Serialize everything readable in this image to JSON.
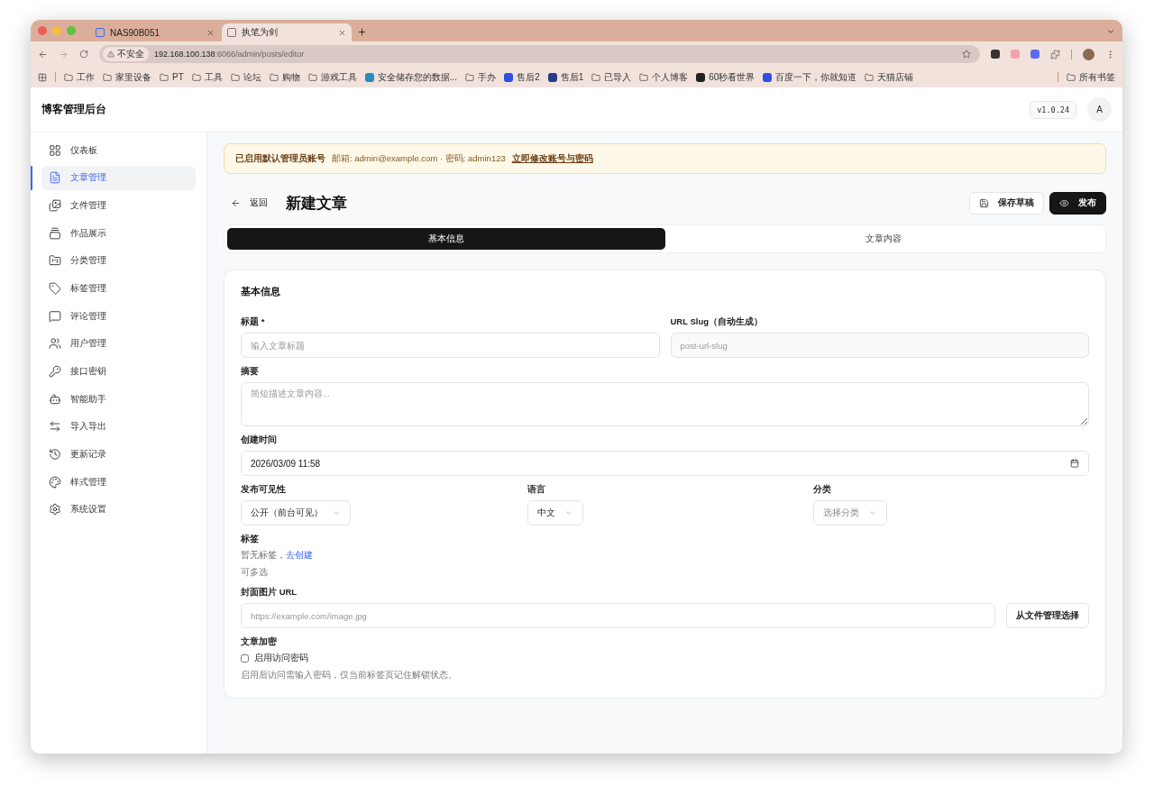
{
  "browser": {
    "tabs": [
      {
        "title": "NAS90B051",
        "selected": false
      },
      {
        "title": "执笔为剑",
        "selected": true
      }
    ],
    "address": {
      "security": "不安全",
      "host": "192.168.100.138",
      "path": ":6066/admin/posts/editor"
    },
    "bookmarks": [
      {
        "kind": "folder",
        "label": "工作"
      },
      {
        "kind": "folder",
        "label": "家里设备"
      },
      {
        "kind": "folder",
        "label": "PT"
      },
      {
        "kind": "folder",
        "label": "工具"
      },
      {
        "kind": "folder",
        "label": "论坛"
      },
      {
        "kind": "folder",
        "label": "购物"
      },
      {
        "kind": "folder",
        "label": "游戏工具"
      },
      {
        "kind": "site",
        "label": "安全储存您的数据..."
      },
      {
        "kind": "folder",
        "label": "手办"
      },
      {
        "kind": "site",
        "label": "售后2"
      },
      {
        "kind": "site",
        "label": "售后1"
      },
      {
        "kind": "folder",
        "label": "已导入"
      },
      {
        "kind": "folder",
        "label": "个人博客"
      },
      {
        "kind": "site",
        "label": "60秒看世界"
      },
      {
        "kind": "site",
        "label": "百度一下，你就知道"
      },
      {
        "kind": "folder",
        "label": "天猫店铺"
      }
    ],
    "all_bookmarks": "所有书签"
  },
  "app": {
    "title": "博客管理后台",
    "version": "v1.0.24",
    "avatar": "A"
  },
  "sidebar": {
    "items": [
      {
        "label": "仪表板",
        "selected": false
      },
      {
        "label": "文章管理",
        "selected": true
      },
      {
        "label": "文件管理",
        "selected": false
      },
      {
        "label": "作品展示",
        "selected": false
      },
      {
        "label": "分类管理",
        "selected": false
      },
      {
        "label": "标签管理",
        "selected": false
      },
      {
        "label": "评论管理",
        "selected": false
      },
      {
        "label": "用户管理",
        "selected": false
      },
      {
        "label": "接口密钥",
        "selected": false
      },
      {
        "label": "智能助手",
        "selected": false
      },
      {
        "label": "导入导出",
        "selected": false
      },
      {
        "label": "更新记录",
        "selected": false
      },
      {
        "label": "样式管理",
        "selected": false
      },
      {
        "label": "系统设置",
        "selected": false
      }
    ]
  },
  "banner": {
    "title": "已启用默认管理员账号",
    "detail": "邮箱: admin@example.com · 密码: admin123",
    "link": "立即修改账号与密码"
  },
  "page": {
    "back": "返回",
    "title": "新建文章",
    "save": "保存草稿",
    "publish": "发布"
  },
  "tabs": [
    {
      "label": "基本信息",
      "selected": true
    },
    {
      "label": "文章内容",
      "selected": false
    }
  ],
  "form": {
    "heading": "基本信息",
    "title": {
      "label": "标题 *",
      "placeholder": "输入文章标题"
    },
    "slug": {
      "label": "URL Slug（自动生成）",
      "placeholder": "post-url-slug"
    },
    "summary": {
      "label": "摘要",
      "placeholder": "简短描述文章内容..."
    },
    "created": {
      "label": "创建时间",
      "value": "2026/03/09 11:58"
    },
    "selects": [
      {
        "label": "发布可见性",
        "value": "公开（前台可见）"
      },
      {
        "label": "语言",
        "value": "中文"
      },
      {
        "label": "分类",
        "placeholder": "选择分类"
      }
    ],
    "tags": {
      "label": "标签",
      "empty": "暂无标签，",
      "link": "去创建",
      "hint": "可多选"
    },
    "cover": {
      "label": "封面图片 URL",
      "placeholder": "https://example.com/image.jpg",
      "button": "从文件管理选择"
    },
    "encryption": {
      "label": "文章加密",
      "checkbox": "启用访问密码",
      "checked": false,
      "hint": "启用后访问需输入密码，仅当前标签页记住解锁状态。"
    }
  }
}
